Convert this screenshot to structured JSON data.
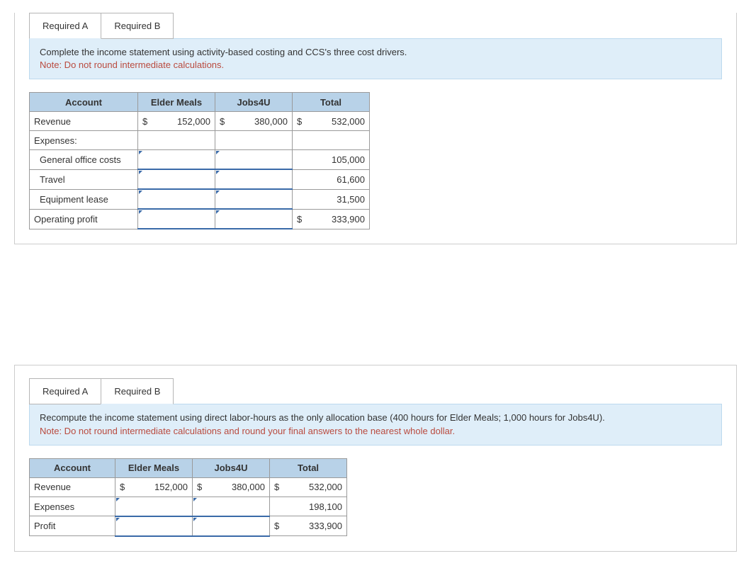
{
  "panelA": {
    "tabs": {
      "a": "Required A",
      "b": "Required B"
    },
    "instr": "Complete the income statement using activity-based costing and CCS's three cost drivers.",
    "note": "Note: Do not round intermediate calculations.",
    "headers": {
      "account": "Account",
      "elder": "Elder Meals",
      "jobs": "Jobs4U",
      "total": "Total"
    },
    "rows": {
      "revenue": {
        "label": "Revenue",
        "elder_cur": "$",
        "elder": "152,000",
        "jobs_cur": "$",
        "jobs": "380,000",
        "total_cur": "$",
        "total": "532,000"
      },
      "expenses": {
        "label": "Expenses:"
      },
      "general": {
        "label": "General office costs",
        "total": "105,000"
      },
      "travel": {
        "label": "Travel",
        "total": "61,600"
      },
      "equip": {
        "label": "Equipment lease",
        "total": "31,500"
      },
      "opprofit": {
        "label": "Operating profit",
        "total_cur": "$",
        "total": "333,900"
      }
    }
  },
  "panelB": {
    "tabs": {
      "a": "Required A",
      "b": "Required B"
    },
    "instr": "Recompute the income statement using direct labor-hours as the only allocation base (400 hours for Elder Meals; 1,000 hours for Jobs4U).",
    "note": "Note: Do not round intermediate calculations and round your final answers to the nearest whole dollar.",
    "headers": {
      "account": "Account",
      "elder": "Elder Meals",
      "jobs": "Jobs4U",
      "total": "Total"
    },
    "rows": {
      "revenue": {
        "label": "Revenue",
        "elder_cur": "$",
        "elder": "152,000",
        "jobs_cur": "$",
        "jobs": "380,000",
        "total_cur": "$",
        "total": "532,000"
      },
      "expenses": {
        "label": "Expenses",
        "total": "198,100"
      },
      "profit": {
        "label": "Profit",
        "total_cur": "$",
        "total": "333,900"
      }
    }
  }
}
